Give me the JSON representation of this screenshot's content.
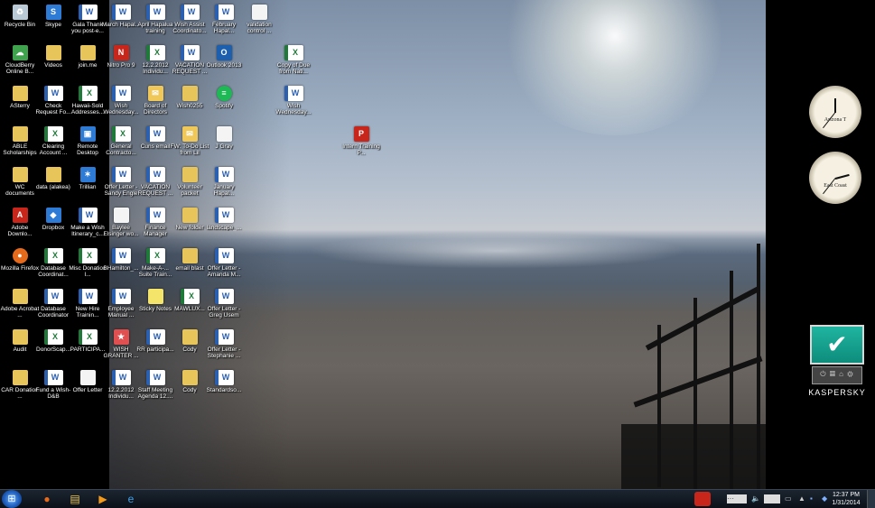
{
  "desktop_icons": [
    {
      "label": "Recycle Bin",
      "icon": "recycle-bin-icon",
      "kind": "recycle",
      "glyph": "♻"
    },
    {
      "label": "CloudBerry Online B...",
      "icon": "cloudberry-icon",
      "kind": "green",
      "glyph": "☁"
    },
    {
      "label": "ASterry",
      "icon": "folder-icon",
      "kind": "folder",
      "glyph": ""
    },
    {
      "label": "ABLE Scholarships",
      "icon": "folder-icon",
      "kind": "folder",
      "glyph": ""
    },
    {
      "label": "WC documents",
      "icon": "folder-icon",
      "kind": "folder",
      "glyph": ""
    },
    {
      "label": "Adobe Downlo...",
      "icon": "adobe-icon",
      "kind": "pdf",
      "glyph": "A"
    },
    {
      "label": "Mozilla Firefox",
      "icon": "firefox-icon",
      "kind": "firefox",
      "glyph": "●"
    },
    {
      "label": "Adobe Acrobat ...",
      "icon": "folder-icon",
      "kind": "folder",
      "glyph": ""
    },
    {
      "label": "Audit",
      "icon": "folder-icon",
      "kind": "folder",
      "glyph": ""
    },
    {
      "label": "CAR Donation ...",
      "icon": "folder-icon",
      "kind": "folder",
      "glyph": ""
    },
    {
      "label": "Skype",
      "icon": "skype-icon",
      "kind": "app",
      "glyph": "S"
    },
    {
      "label": "Videos",
      "icon": "folder-icon",
      "kind": "folder",
      "glyph": ""
    },
    {
      "label": "Check Request Fo...",
      "icon": "word-doc-icon",
      "kind": "word",
      "glyph": "W"
    },
    {
      "label": "Clearing Account ...",
      "icon": "excel-doc-icon",
      "kind": "excel",
      "glyph": "X"
    },
    {
      "label": "data (alakea)",
      "icon": "folder-icon",
      "kind": "folder",
      "glyph": ""
    },
    {
      "label": "Dropbox",
      "icon": "dropbox-icon",
      "kind": "app",
      "glyph": "◆"
    },
    {
      "label": "Database Coordinat...",
      "icon": "excel-doc-icon",
      "kind": "excel",
      "glyph": "X"
    },
    {
      "label": "Database Coordinator",
      "icon": "word-doc-icon",
      "kind": "word",
      "glyph": "W"
    },
    {
      "label": "DonorScap...",
      "icon": "excel-doc-icon",
      "kind": "excel",
      "glyph": "X"
    },
    {
      "label": "Fund a Wish-D&B",
      "icon": "word-doc-icon",
      "kind": "word",
      "glyph": "W"
    },
    {
      "label": "Gala Thank you post-e...",
      "icon": "word-doc-icon",
      "kind": "word",
      "glyph": "W"
    },
    {
      "label": "join.me",
      "icon": "folder-icon",
      "kind": "folder",
      "glyph": ""
    },
    {
      "label": "Hawaii-Sold Addresses...",
      "icon": "excel-doc-icon",
      "kind": "excel",
      "glyph": "X"
    },
    {
      "label": "Remote Desktop",
      "icon": "remote-desktop-icon",
      "kind": "app",
      "glyph": "▣"
    },
    {
      "label": "Trillian",
      "icon": "trillian-icon",
      "kind": "app",
      "glyph": "✶"
    },
    {
      "label": "Make a Wish Itinerary_c...",
      "icon": "word-doc-icon",
      "kind": "word",
      "glyph": "W"
    },
    {
      "label": "Misc Donation I...",
      "icon": "excel-doc-icon",
      "kind": "excel",
      "glyph": "X"
    },
    {
      "label": "New Hire Trainin...",
      "icon": "word-doc-icon",
      "kind": "word",
      "glyph": "W"
    },
    {
      "label": "PARTICIPA...",
      "icon": "excel-doc-icon",
      "kind": "excel",
      "glyph": "X"
    },
    {
      "label": "Offer Letter",
      "icon": "blank-doc-icon",
      "kind": "blank",
      "glyph": ""
    },
    {
      "label": "March Hapal...",
      "icon": "word-doc-icon",
      "kind": "word",
      "glyph": "W"
    },
    {
      "label": "Nitro Pro 9",
      "icon": "nitro-pdf-icon",
      "kind": "pdf",
      "glyph": "N"
    },
    {
      "label": "Wish Wednesday...",
      "icon": "word-doc-icon",
      "kind": "word",
      "glyph": "W"
    },
    {
      "label": "General Contracto...",
      "icon": "excel-doc-icon",
      "kind": "excel",
      "glyph": "X"
    },
    {
      "label": "Offer Letter - Sandy Engle",
      "icon": "word-doc-icon",
      "kind": "word",
      "glyph": "W"
    },
    {
      "label": "Baylee Elsinger wo...",
      "icon": "blank-doc-icon",
      "kind": "blank",
      "glyph": ""
    },
    {
      "label": "BHamilton_...",
      "icon": "word-doc-icon",
      "kind": "word",
      "glyph": "W"
    },
    {
      "label": "Employee Manual ...",
      "icon": "word-doc-icon",
      "kind": "word",
      "glyph": "W"
    },
    {
      "label": "WISH GRANTER ...",
      "icon": "wish-icon",
      "kind": "wish",
      "glyph": "★"
    },
    {
      "label": "12.2.2012 Individu...",
      "icon": "word-doc-icon",
      "kind": "word",
      "glyph": "W"
    },
    {
      "label": "April Hapalua training",
      "icon": "word-doc-icon",
      "kind": "word",
      "glyph": "W"
    },
    {
      "label": "12.2.2012 Individu...",
      "icon": "excel-doc-icon",
      "kind": "excel",
      "glyph": "X"
    },
    {
      "label": "Board of Directors",
      "icon": "mail-icon",
      "kind": "mail",
      "glyph": "✉"
    },
    {
      "label": "Cuns email",
      "icon": "word-doc-icon",
      "kind": "word",
      "glyph": "W"
    },
    {
      "label": "VACATION REQUEST ...",
      "icon": "word-doc-icon",
      "kind": "word",
      "glyph": "W"
    },
    {
      "label": "Finance Manager",
      "icon": "word-doc-icon",
      "kind": "word",
      "glyph": "W"
    },
    {
      "label": "Make-A-... Suite Train...",
      "icon": "excel-doc-icon",
      "kind": "excel",
      "glyph": "X"
    },
    {
      "label": "Sticky Notes",
      "icon": "sticky-notes-icon",
      "kind": "sticky",
      "glyph": ""
    },
    {
      "label": "RR participa...",
      "icon": "word-doc-icon",
      "kind": "word",
      "glyph": "W"
    },
    {
      "label": "Staff Meeting Agenda 12....",
      "icon": "word-doc-icon",
      "kind": "word",
      "glyph": "W"
    },
    {
      "label": "Wish Assist Coordinato...",
      "icon": "word-doc-icon",
      "kind": "word",
      "glyph": "W"
    },
    {
      "label": "VACATION REQUEST ...",
      "icon": "word-doc-icon",
      "kind": "word",
      "glyph": "W"
    },
    {
      "label": "Wish0255",
      "icon": "folder-icon",
      "kind": "folder",
      "glyph": ""
    },
    {
      "label": "FW: To-Do List from Lil",
      "icon": "mail-icon",
      "kind": "mail",
      "glyph": "✉"
    },
    {
      "label": "Volunteer packet",
      "icon": "folder-icon",
      "kind": "folder",
      "glyph": ""
    },
    {
      "label": "New folder",
      "icon": "folder-icon",
      "kind": "folder",
      "glyph": ""
    },
    {
      "label": "email blast",
      "icon": "folder-icon",
      "kind": "folder",
      "glyph": ""
    },
    {
      "label": "MAWLUX...",
      "icon": "excel-doc-icon",
      "kind": "excel",
      "glyph": "X"
    },
    {
      "label": "Cody",
      "icon": "folder-icon",
      "kind": "folder",
      "glyph": ""
    },
    {
      "label": "Cody",
      "icon": "folder-icon",
      "kind": "folder",
      "glyph": ""
    },
    {
      "label": "February Hapal...",
      "icon": "word-doc-icon",
      "kind": "word",
      "glyph": "W"
    },
    {
      "label": "Outlook 2013",
      "icon": "outlook-icon",
      "kind": "outlook",
      "glyph": "O"
    },
    {
      "label": "Spotify",
      "icon": "spotify-icon",
      "kind": "spotify",
      "glyph": "≡"
    },
    {
      "label": "J Gray",
      "icon": "blank-doc-icon",
      "kind": "blank",
      "glyph": ""
    },
    {
      "label": "January Hapal...",
      "icon": "word-doc-icon",
      "kind": "word",
      "glyph": "W"
    },
    {
      "label": "landscape_...",
      "icon": "word-doc-icon",
      "kind": "word",
      "glyph": "W"
    },
    {
      "label": "Offer Letter - Amanda M...",
      "icon": "word-doc-icon",
      "kind": "word",
      "glyph": "W"
    },
    {
      "label": "Offer Letter - Greg Usem",
      "icon": "word-doc-icon",
      "kind": "word",
      "glyph": "W"
    },
    {
      "label": "Offer Letter - Stephanie ...",
      "icon": "word-doc-icon",
      "kind": "word",
      "glyph": "W"
    },
    {
      "label": "Standardso...",
      "icon": "word-doc-icon",
      "kind": "word",
      "glyph": "W"
    },
    {
      "label": "validation control ...",
      "icon": "blank-doc-icon",
      "kind": "blank",
      "glyph": ""
    },
    {
      "label": "Copy of Due from Nati...",
      "icon": "excel-doc-icon",
      "kind": "excel",
      "glyph": "X"
    },
    {
      "label": "Wish Wednesday...",
      "icon": "word-doc-icon",
      "kind": "word",
      "glyph": "W"
    },
    {
      "label": "Intern Training P...",
      "icon": "powerpoint-doc-icon",
      "kind": "pdf",
      "glyph": "P"
    }
  ],
  "gadgets": {
    "clock1_label": "Arizona T",
    "clock2_label": "East Coast",
    "kaspersky_brand": "KASPERSKY"
  },
  "taskbar": {
    "start_label": "Start",
    "pinned": [
      {
        "name": "taskbar-firefox",
        "icon": "firefox-icon",
        "glyph": "●",
        "color": "#e66a1c"
      },
      {
        "name": "taskbar-explorer",
        "icon": "folder-icon",
        "glyph": "▤",
        "color": "#e8c55a"
      },
      {
        "name": "taskbar-media-player",
        "icon": "media-player-icon",
        "glyph": "▶",
        "color": "#f39a1b"
      },
      {
        "name": "taskbar-internet-explorer",
        "icon": "internet-explorer-icon",
        "glyph": "e",
        "color": "#3fa0e8"
      }
    ],
    "time": "12:37 PM",
    "date": "1/31/2014"
  }
}
